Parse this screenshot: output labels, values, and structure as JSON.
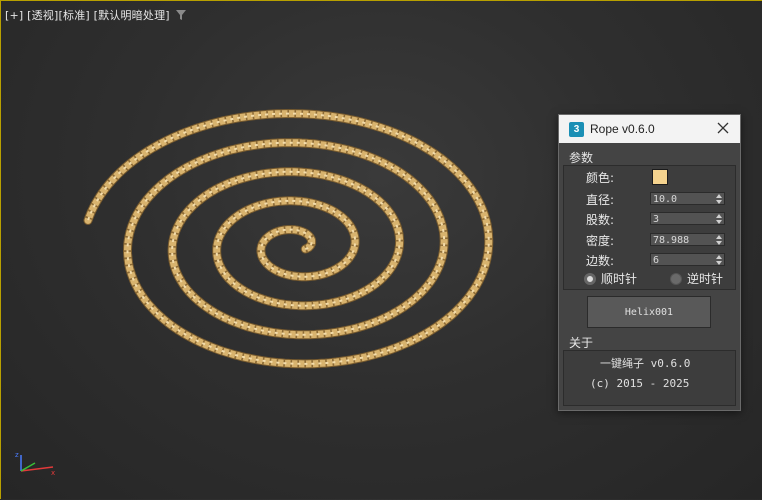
{
  "viewport": {
    "labels": [
      "[+]",
      "[透视]",
      "[标准]",
      "[默认明暗处理]"
    ],
    "rope_color": "#d8b36e",
    "accent": "#b8a000"
  },
  "dialog": {
    "title": "Rope v0.6.0",
    "icon_text": "3",
    "params_label": "参数",
    "color_label": "颜色:",
    "color_value": "#f5d38e",
    "fields": [
      {
        "label": "直径:",
        "value": "10.0"
      },
      {
        "label": "股数:",
        "value": "3"
      },
      {
        "label": "密度:",
        "value": "78.988"
      },
      {
        "label": "边数:",
        "value": "6"
      }
    ],
    "radio_cw": "顺时针",
    "radio_ccw": "逆时针",
    "pick_button": "Helix001",
    "about_label": "关于",
    "about_name": "一键绳子 v0.6.0",
    "about_copyright": "(c) 2015 - 2025"
  }
}
